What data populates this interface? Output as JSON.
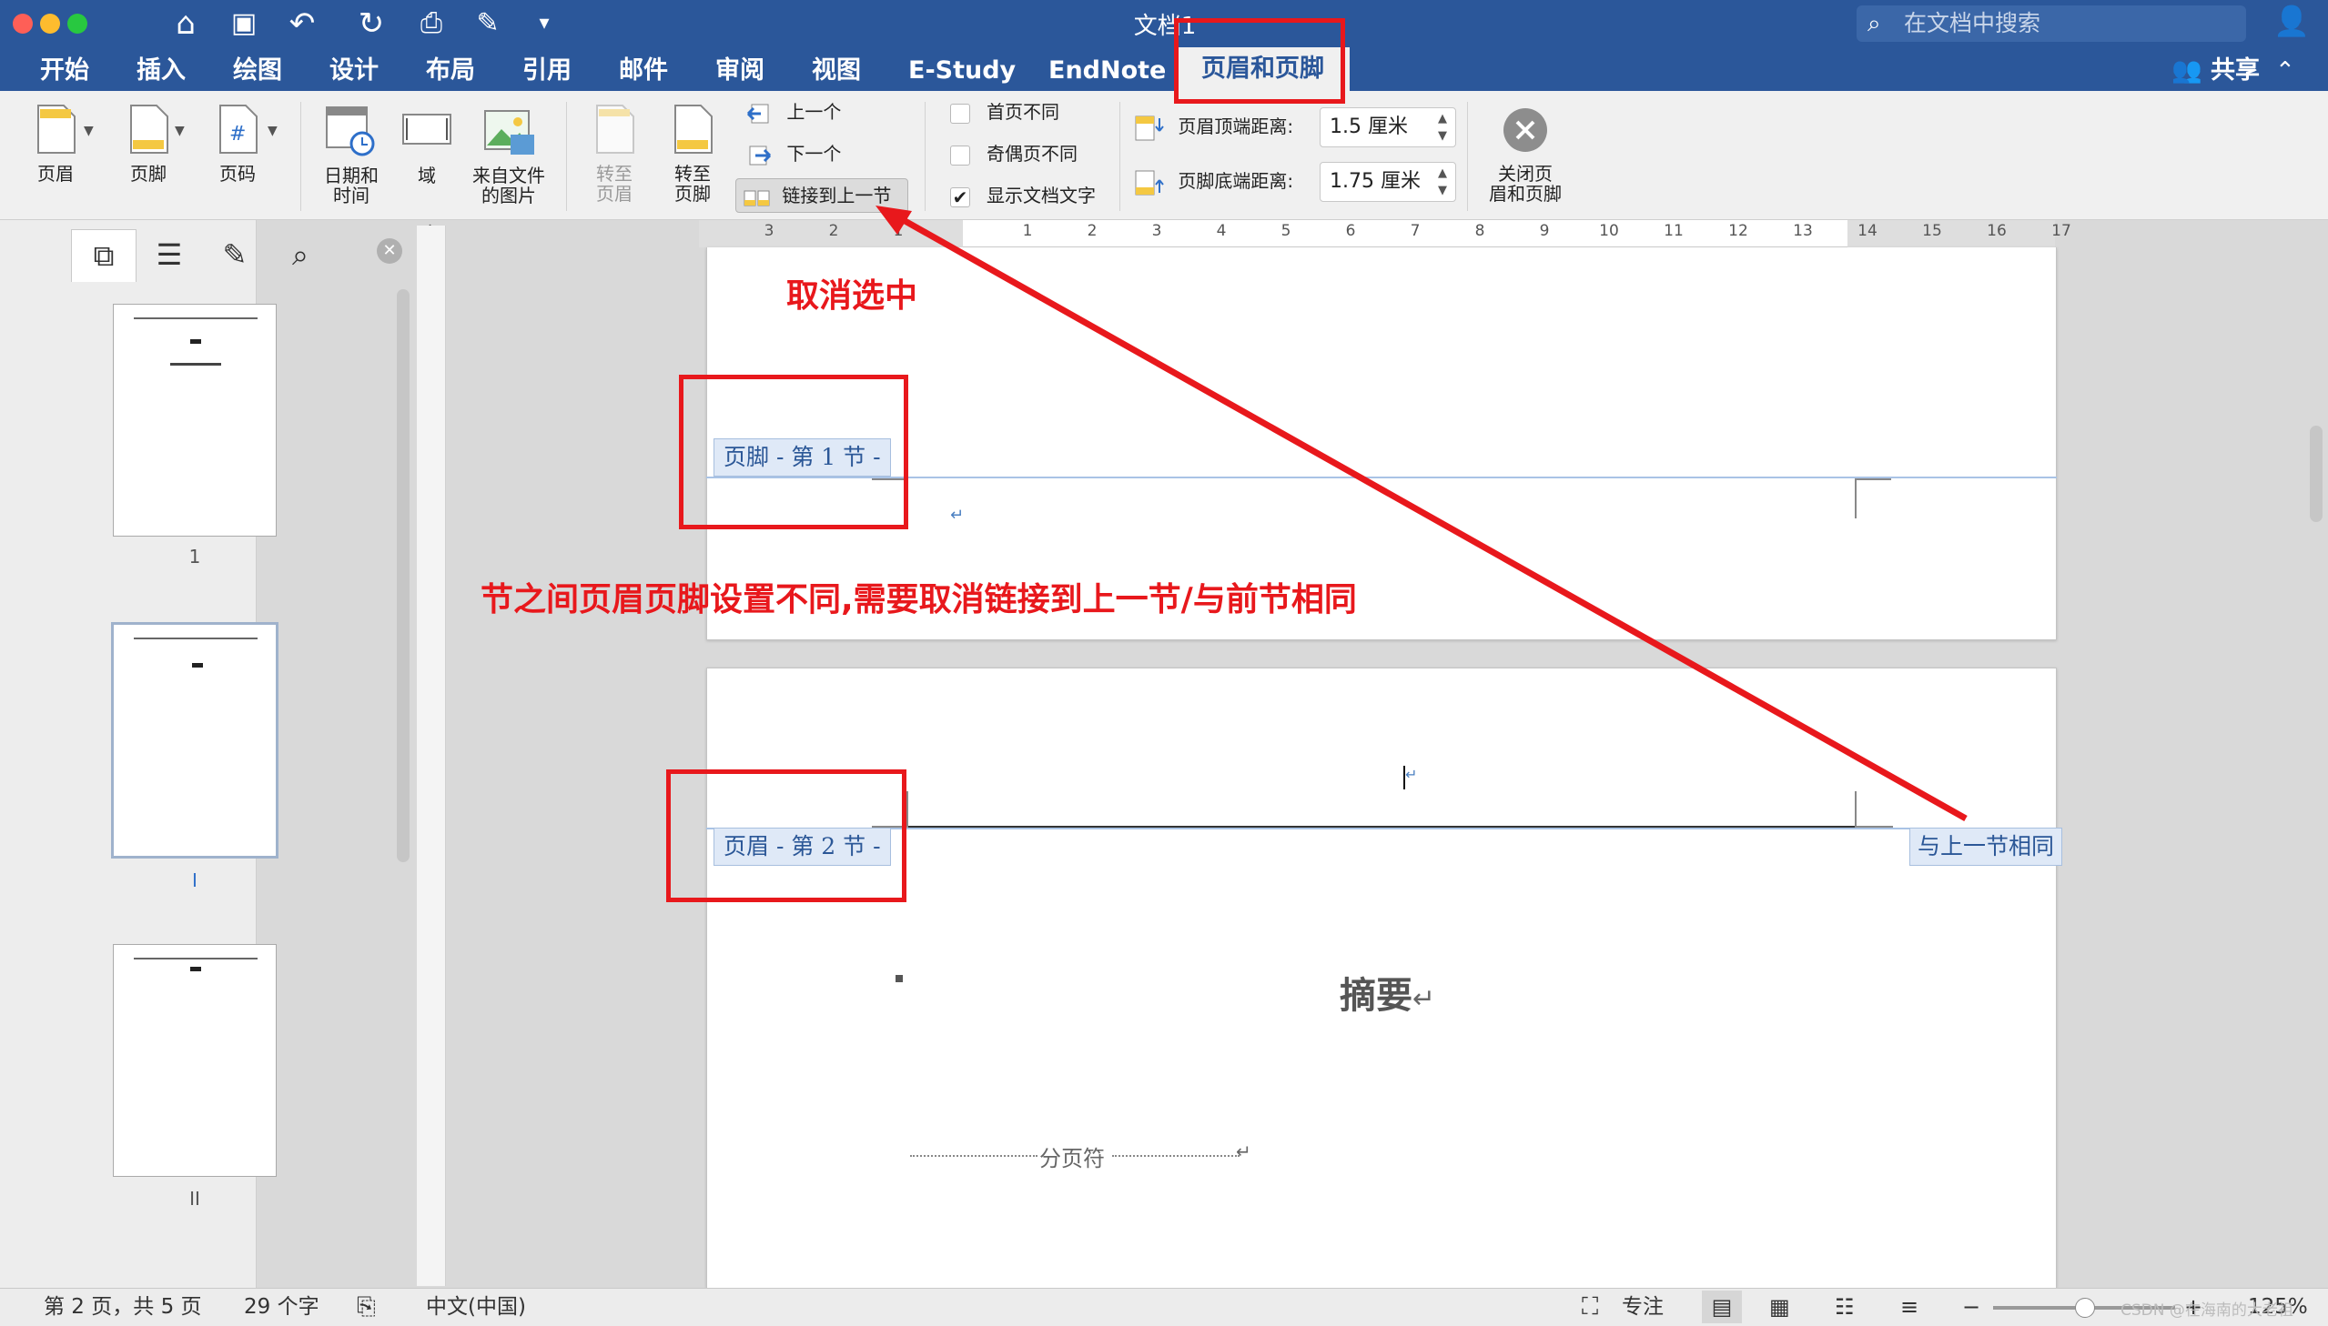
{
  "titlebar": {
    "doc_title": "文档1",
    "search_placeholder": "在文档中搜索",
    "share_label": "共享"
  },
  "tabs": [
    {
      "label": "开始"
    },
    {
      "label": "插入"
    },
    {
      "label": "绘图"
    },
    {
      "label": "设计"
    },
    {
      "label": "布局"
    },
    {
      "label": "引用"
    },
    {
      "label": "邮件"
    },
    {
      "label": "审阅"
    },
    {
      "label": "视图"
    },
    {
      "label": "E-Study"
    },
    {
      "label": "EndNote"
    },
    {
      "label": "页眉和页脚",
      "active": true
    }
  ],
  "ribbon": {
    "header_label": "页眉",
    "footer_label": "页脚",
    "page_number_label": "页码",
    "datetime_label_1": "日期和",
    "datetime_label_2": "时间",
    "field_label": "域",
    "picture_label_1": "来自文件",
    "picture_label_2": "的图片",
    "goto_header_1": "转至",
    "goto_header_2": "页眉",
    "goto_footer_1": "转至",
    "goto_footer_2": "页脚",
    "previous_label": "上一个",
    "next_label": "下一个",
    "link_previous_label": "链接到上一节",
    "first_page_label": "首页不同",
    "odd_even_label": "奇偶页不同",
    "show_doc_text_label": "显示文档文字",
    "header_top_label": "页眉顶端距离:",
    "header_top_value": "1.5 厘米",
    "footer_bottom_label": "页脚底端距离:",
    "footer_bottom_value": "1.75 厘米",
    "close_label_1": "关闭页",
    "close_label_2": "眉和页脚"
  },
  "sidebar": {
    "thumbnails": [
      {
        "label": "1"
      },
      {
        "label": "I"
      },
      {
        "label": "II"
      }
    ]
  },
  "ruler": {
    "numbers": [
      "3",
      "2",
      "1",
      "1",
      "2",
      "3",
      "4",
      "5",
      "6",
      "7",
      "8",
      "9",
      "10",
      "11",
      "12",
      "13",
      "14",
      "15",
      "16",
      "17"
    ]
  },
  "document": {
    "footer_tag": "页脚 - 第 1 节 -",
    "header_tag": "页眉 - 第 2 节 -",
    "same_as_previous": "与上一节相同",
    "abstract_title": "摘要",
    "page_break_label": "分页符"
  },
  "annotations": {
    "uncheck_text": "取消选中",
    "note_text": "节之间页眉页脚设置不同,需要取消链接到上一节/与前节相同",
    "color": "#e8181c"
  },
  "statusbar": {
    "page_info": "第 2 页，共 5 页",
    "word_count": "29 个字",
    "language": "中文(中国)",
    "focus_label": "专注",
    "zoom": "125%",
    "watermark": "CSDN @在海南的大老祖"
  }
}
